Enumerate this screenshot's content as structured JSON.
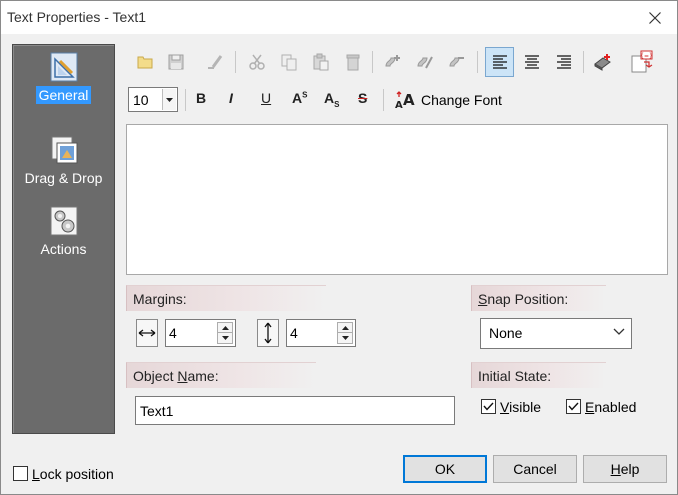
{
  "window": {
    "title": "Text Properties - Text1"
  },
  "nav": {
    "items": [
      {
        "label": "General",
        "icon": "general-pencil-triangle-icon",
        "selected": true
      },
      {
        "label": "Drag & Drop",
        "icon": "drag-drop-icon",
        "selected": false
      },
      {
        "label": "Actions",
        "icon": "actions-gears-icon",
        "selected": false
      }
    ]
  },
  "toolbar": {
    "buttons": [
      "open-icon",
      "save-icon",
      "clear-format-icon",
      "cut-icon",
      "copy-icon",
      "paste-icon",
      "delete-icon",
      "add-link-icon",
      "edit-link-icon",
      "remove-link-icon",
      "align-left-icon",
      "align-center-icon",
      "align-right-icon",
      "eraser-icon",
      "insert-field-icon"
    ],
    "active": "align-left-icon"
  },
  "format": {
    "font_size": "10",
    "bold_label": "B",
    "italic_label": "I",
    "underline_label": "U",
    "superscript_label": "A",
    "superscript_suffix": "S",
    "subscript_label": "A",
    "subscript_suffix": "S",
    "strike_label": "S",
    "change_font_label": "Change Font"
  },
  "text_content": "",
  "margins": {
    "label": "Margins:",
    "horizontal_value": "4",
    "vertical_value": "4"
  },
  "snap": {
    "label_prefix": "",
    "label_underline": "S",
    "label_rest": "nap Position:",
    "value": "None"
  },
  "object_name": {
    "label_prefix": "Object ",
    "label_underline": "N",
    "label_rest": "ame:",
    "value": "Text1"
  },
  "initial_state": {
    "label": "Initial State:",
    "visible_underline": "V",
    "visible_rest": "isible",
    "visible_checked": true,
    "enabled_underline": "E",
    "enabled_rest": "nabled",
    "enabled_checked": true
  },
  "lock_position": {
    "underline": "L",
    "rest": "ock position",
    "checked": false
  },
  "buttons": {
    "ok": "OK",
    "cancel": "Cancel",
    "help_underline": "H",
    "help_rest": "elp"
  },
  "colors": {
    "nav_bg": "#6b6b6b",
    "selected": "#3399ff",
    "group_head": "#e6d7d8",
    "default_button_border": "#0078d7"
  }
}
